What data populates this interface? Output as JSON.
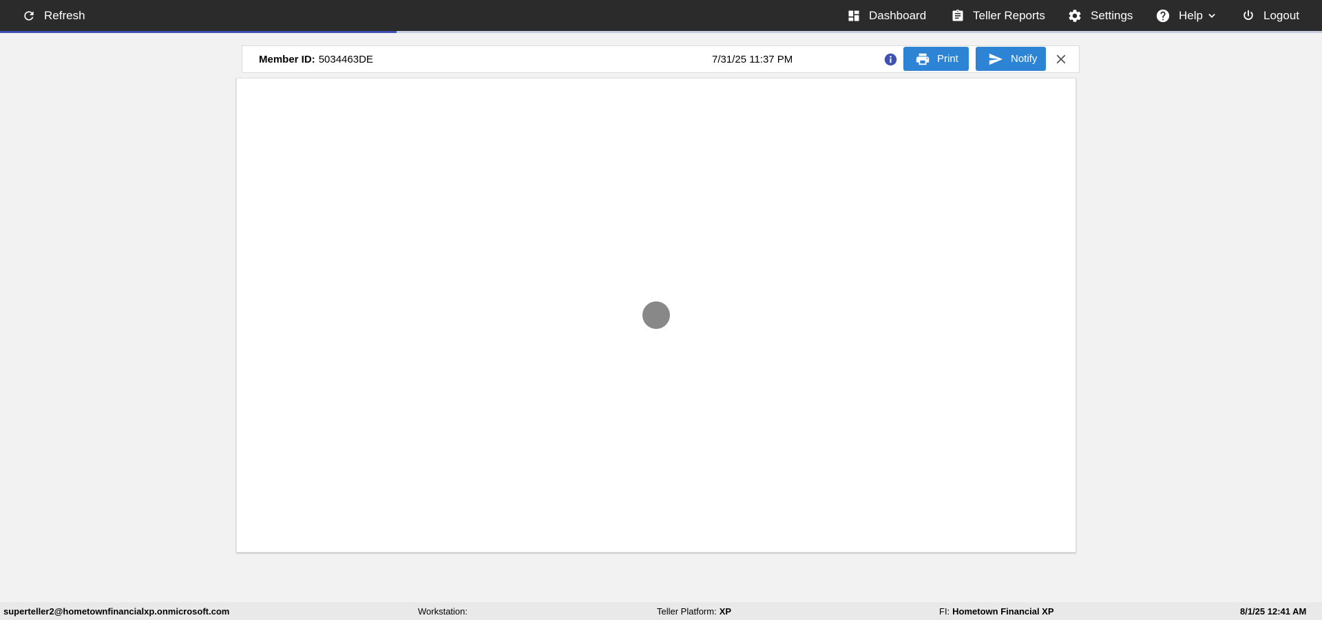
{
  "topbar": {
    "refresh_label": "Refresh",
    "dashboard_label": "Dashboard",
    "reports_label": "Teller Reports",
    "settings_label": "Settings",
    "help_label": "Help",
    "logout_label": "Logout",
    "background_color": "#2b2b2b"
  },
  "loading": {
    "progress": 0.3,
    "bar_color": "#3f51b5"
  },
  "header": {
    "member_id_label": "Member ID:",
    "member_id_value": "5034463DE",
    "timestamp": "7/31/25 11:37 PM",
    "info_icon": "info-icon",
    "print_label": "Print",
    "notify_label": "Notify",
    "button_color": "#2d84d4"
  },
  "footer": {
    "user": "superteller2@hometownfinancialxp.onmicrosoft.com",
    "workstation_label": "Workstation:",
    "workstation_value": "",
    "platform_label": "Teller Platform:",
    "platform_value": "XP",
    "fi_label": "FI:",
    "fi_value": "Hometown Financial XP",
    "datetime": "8/1/25 12:41 AM"
  }
}
